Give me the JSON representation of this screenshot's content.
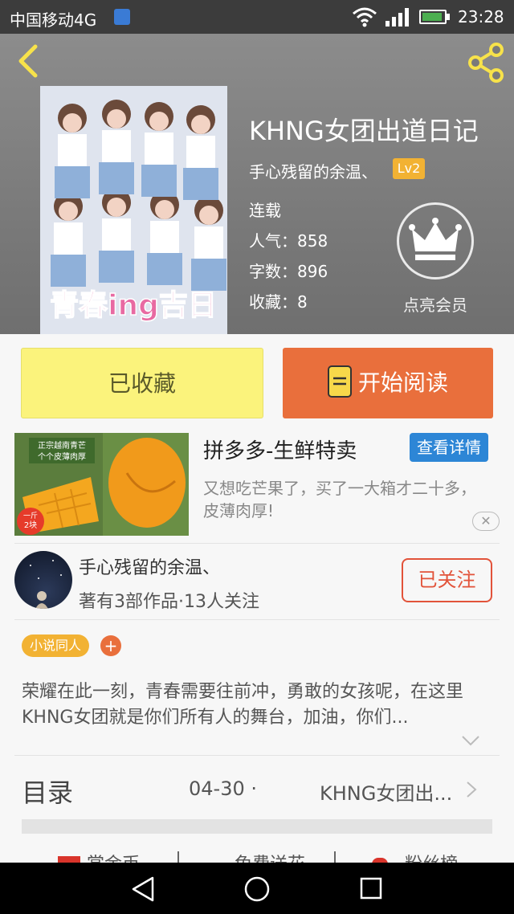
{
  "status_bar": {
    "carrier": "中国移动4G",
    "network": "4G",
    "time": "23:28"
  },
  "book": {
    "title": "KHNG女团出道日记",
    "author": "手心残留的余温、",
    "author_level": "Lv2",
    "status": "连载",
    "popularity": "人气：858",
    "word_count": "字数：896",
    "favorites": "收藏：8",
    "cover_text": "青春ing吉日"
  },
  "vip": {
    "label": "点亮会员"
  },
  "actions": {
    "collected_label": "已收藏",
    "read_label": "开始阅读"
  },
  "ad": {
    "title": "拼多多-生鲜特卖",
    "button": "查看详情",
    "description": "又想吃芒果了，买了一大箱才二十多，皮薄肉厚!",
    "image_caption": "正宗越南青芒 个个皮薄肉厚",
    "image_price": "一斤2块"
  },
  "author_card": {
    "name": "手心残留的余温、",
    "stats": "著有3部作品·13人关注",
    "follow_label": "已关注"
  },
  "tags": {
    "items": [
      "小说同人"
    ],
    "add": "+"
  },
  "description": "荣耀在此一刻，青春需要往前冲，勇敢的女孩呢，在这里KHNG女团就是你们所有人的舞台，加油，你们...",
  "toc": {
    "label": "目录",
    "date": "04-30 ·",
    "latest_chapter": "KHNG女团出..."
  },
  "bottom_tabs": [
    "赏金币",
    "免费送花",
    "粉丝榜"
  ],
  "colors": {
    "accent_orange": "#e96f3c",
    "collect_yellow": "#fbf37c",
    "tag_gold": "#f2b233",
    "follow_red": "#e2533a",
    "ad_blue": "#2d86d6"
  }
}
